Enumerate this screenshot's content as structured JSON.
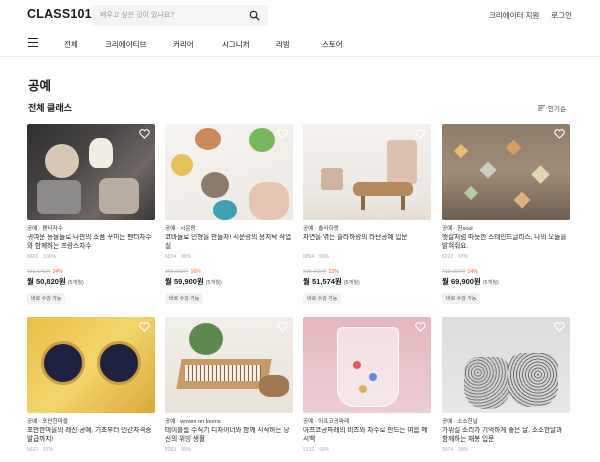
{
  "brand": {
    "logo": "CLASS101"
  },
  "search": {
    "placeholder": "배우고 싶은 것이 있나요?"
  },
  "top_links": {
    "creator_support": "크리에이터 지원",
    "login": "로그인"
  },
  "nav": {
    "items": [
      "전체",
      "크리에이티브",
      "커리어",
      "시그니처",
      "리빙",
      "스토어"
    ]
  },
  "category_title": "공예",
  "section_title": "전체 클래스",
  "sort_label": "인기순",
  "colors": {
    "discount": "#ff5b2e",
    "text": "#1a1a1a",
    "muted": "#aaaaaa"
  },
  "cards": [
    {
      "creator": "공예 · 펜타자수",
      "title": "귀여운 동물들로 나만의 소품 꾸미는 펜터자수와 함께하는 프랑스자수",
      "likes": "6603",
      "satisfaction": "100%",
      "orig": "165,645원",
      "discount": "34%",
      "price": "월 50,820원",
      "months": "(5개월)",
      "badge": "바로 수강 가능"
    },
    {
      "creator": "공예 · 시운랑",
      "title": "코바늘로 인형을 만들자! 시운랑의 용지탁 작업실",
      "likes": "6934",
      "satisfaction": "99%",
      "orig": "355,500원",
      "discount": "16%",
      "price": "월 59,900원",
      "months": "(5개월)",
      "badge": "바로 수강 가능"
    },
    {
      "creator": "공예 · 솔라하랑",
      "title": "자연을 엮는 솔라하랑의 라탄공예 입문",
      "likes": "6854",
      "satisfaction": "99%",
      "orig": "335,400원",
      "discount": "23%",
      "price": "월 51,574원",
      "months": "(5개월)",
      "badge": "바로 수강 가능"
    },
    {
      "creator": "공예 · 창soul",
      "title": "햇살처럼 따듯한 스테인드글라스, 나의 오늘을 밝혀줘요.",
      "likes": "6222",
      "satisfaction": "97%",
      "orig": "410,200원",
      "discount": "14%",
      "price": "월 69,900원",
      "months": "(5개월)",
      "badge": "바로 수강 가능"
    },
    {
      "creator": "공예 · 포만한마을",
      "title": "포만한마을의 레진 공예, 기초부터 인간자격증 발급까지!",
      "likes": "5622",
      "satisfaction": "97%"
    },
    {
      "creator": "공예 · woven on looms",
      "title": "테이블룸 수직기 디자이너와 함께 시작하는 당신의 위빙 생활",
      "likes": "5293",
      "satisfaction": "99%"
    },
    {
      "creator": "공예 · 아프코공파레",
      "title": "아프코공파레의 비즈와 자수로 만드는 여름 메시백",
      "likes": "5132",
      "satisfaction": "99%"
    },
    {
      "creator": "공예 · 소소한날",
      "title": "가위질 소리가 기억하게 좋은 날, 소소한날과 함께하는 재봉 입문",
      "likes": "5074",
      "satisfaction": "99%"
    }
  ]
}
